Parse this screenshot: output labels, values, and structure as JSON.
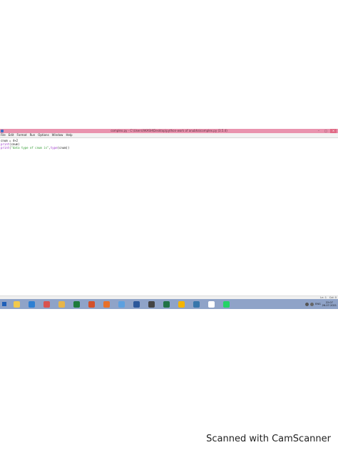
{
  "window": {
    "title": "complex.py - C:\\Users\\AKASH\\Desktop\\python-work of anubha\\complex.py (3.5.4)",
    "controls": {
      "minimize": "–",
      "maximize": "□",
      "close": "×"
    }
  },
  "menu": {
    "items": [
      "File",
      "Edit",
      "Format",
      "Run",
      "Options",
      "Window",
      "Help"
    ]
  },
  "editor": {
    "lines": [
      {
        "plain": "cnum = 4+2"
      },
      {
        "kw": "print",
        "plain": "(cnum)"
      },
      {
        "kw": "print",
        "plain": "(",
        "str": "\"data type of cnum is\"",
        "plain2": ",",
        "bi": "type",
        "plain3": "(cnum))"
      }
    ]
  },
  "status": {
    "line": "Ln: 1",
    "col": "Col: 0"
  },
  "taskbar": {
    "apps": [
      {
        "name": "file-explorer",
        "color": "#f2c94c"
      },
      {
        "name": "ie",
        "color": "#2d7fd3"
      },
      {
        "name": "chrome-like",
        "color": "#d9534f"
      },
      {
        "name": "folder",
        "color": "#e7b54a"
      },
      {
        "name": "excel",
        "color": "#1e7b3c"
      },
      {
        "name": "powerpoint",
        "color": "#d2502b"
      },
      {
        "name": "firefox",
        "color": "#e8702a"
      },
      {
        "name": "weather",
        "color": "#5ca0e0"
      },
      {
        "name": "word",
        "color": "#2b579a"
      },
      {
        "name": "media",
        "color": "#444444"
      },
      {
        "name": "excel2",
        "color": "#217346"
      },
      {
        "name": "chrome",
        "color": "#f4b400"
      },
      {
        "name": "python",
        "color": "#3776ab"
      },
      {
        "name": "amazon",
        "color": "#ffffff"
      },
      {
        "name": "whatsapp",
        "color": "#25d366"
      }
    ],
    "tray": {
      "lang": "ENG",
      "time": "22:07",
      "date": "26-07-2021"
    }
  },
  "watermark": "Scanned with CamScanner"
}
